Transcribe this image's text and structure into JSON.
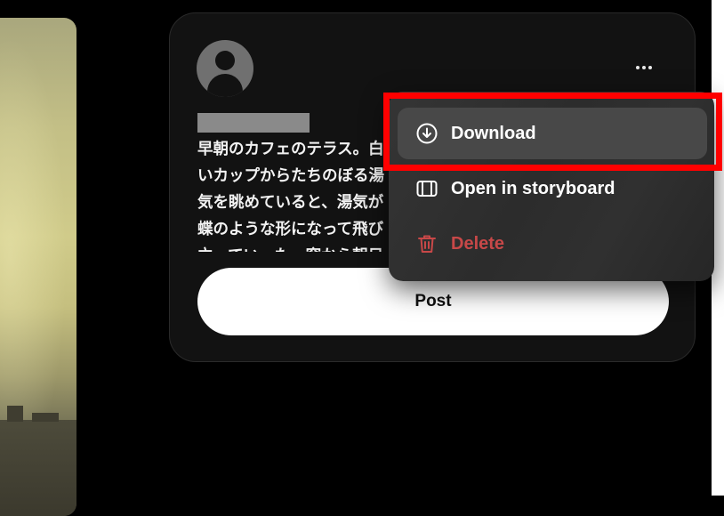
{
  "composer": {
    "caption": "早朝のカフェのテラス。白いカップからたちのぼる湯気を眺めていると、湯気が蝶のような形になって飛び立っていった。窓から朝日が差し込み、金色の光の中をひらひらと舞う。私は目を細めて見送り、再び",
    "post_label": "Post"
  },
  "menu": {
    "items": [
      {
        "label": "Download",
        "icon": "download-circle-icon"
      },
      {
        "label": "Open in storyboard",
        "icon": "storyboard-icon"
      },
      {
        "label": "Delete",
        "icon": "trash-icon"
      }
    ]
  },
  "colors": {
    "background": "#000000",
    "card": "#121212",
    "menu": "#2f2f2f",
    "menu_highlight": "#484848",
    "delete": "#c84848",
    "annotation": "#ff0000",
    "post_button": "#ffffff"
  }
}
